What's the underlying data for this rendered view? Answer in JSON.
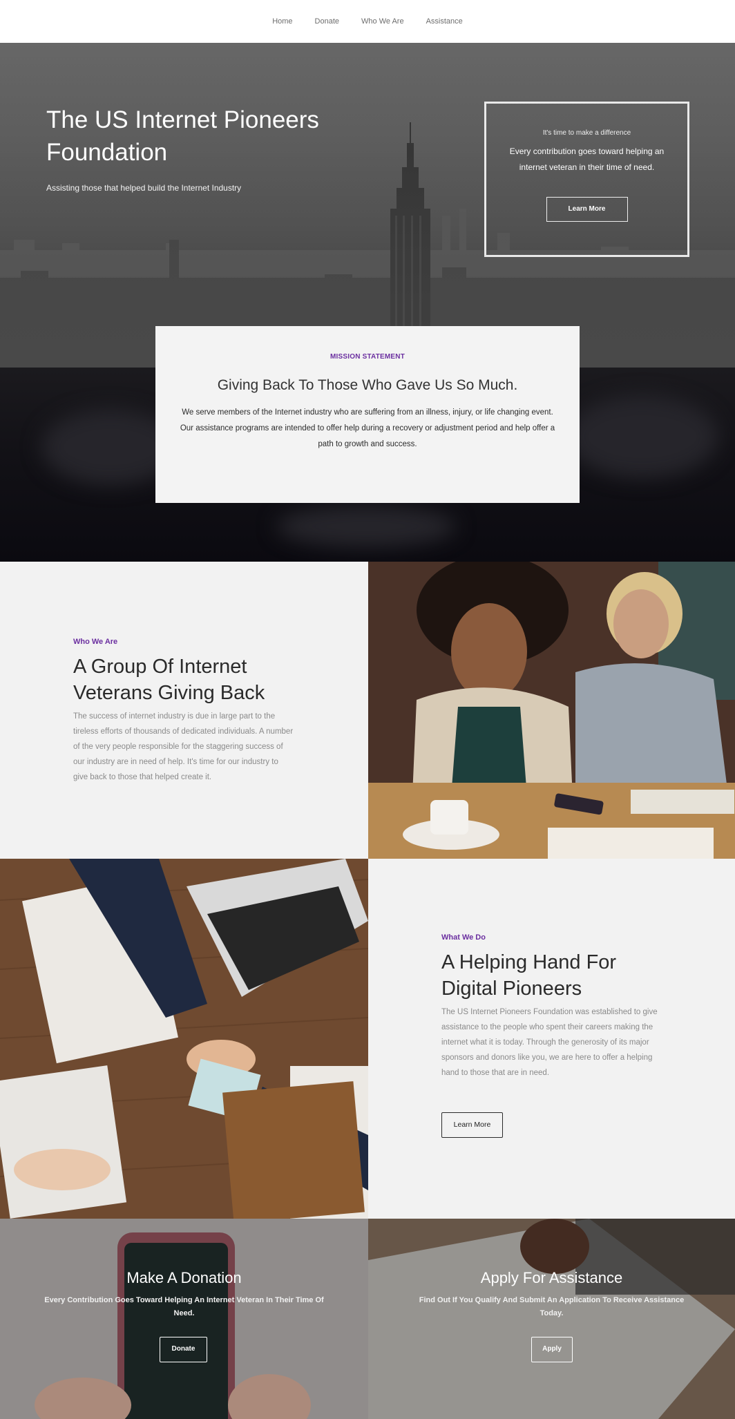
{
  "nav": {
    "items": [
      "Home",
      "Donate",
      "Who We Are",
      "Assistance"
    ]
  },
  "hero": {
    "title": "The US Internet Pioneers Foundation",
    "subtitle": "Assisting those that helped build the Internet Industry",
    "box": {
      "small": "It's time to make a difference",
      "text": "Every contribution goes toward helping an internet veteran in their time of need.",
      "button": "Learn More"
    }
  },
  "mission": {
    "label": "MISSION STATEMENT",
    "title": "Giving Back To Those Who Gave Us So Much.",
    "text": "We serve members of the Internet industry who are suffering from an illness, injury, or life changing event. Our assistance programs are intended to offer help during a recovery or adjustment period and help offer a path to growth and success."
  },
  "who_we_are": {
    "eyebrow": "Who We Are",
    "title": "A Group Of Internet Veterans Giving Back",
    "text": "The success of internet industry is due in large part to the tireless efforts of thousands of dedicated individuals. A number of the very people responsible for the staggering success of our industry are in need of help. It's time for our industry to give back to those that helped create it."
  },
  "what_we_do": {
    "eyebrow": "What We Do",
    "title": "A Helping Hand For Digital Pioneers",
    "text": "The US Internet Pioneers Foundation was established to give assistance to the people who spent their careers making the internet what it is today. Through the generosity of its major sponsors and donors like you, we are here to offer a helping hand to those that are in need.",
    "button": "Learn More"
  },
  "donation": {
    "title": "Make A Donation",
    "text": "Every Contribution Goes Toward Helping An Internet Veteran In Their Time Of Need.",
    "button": "Donate"
  },
  "assistance": {
    "title": "Apply For Assistance",
    "text": "Find Out If You Qualify And Submit An Application To Receive Assistance Today.",
    "button": "Apply"
  }
}
